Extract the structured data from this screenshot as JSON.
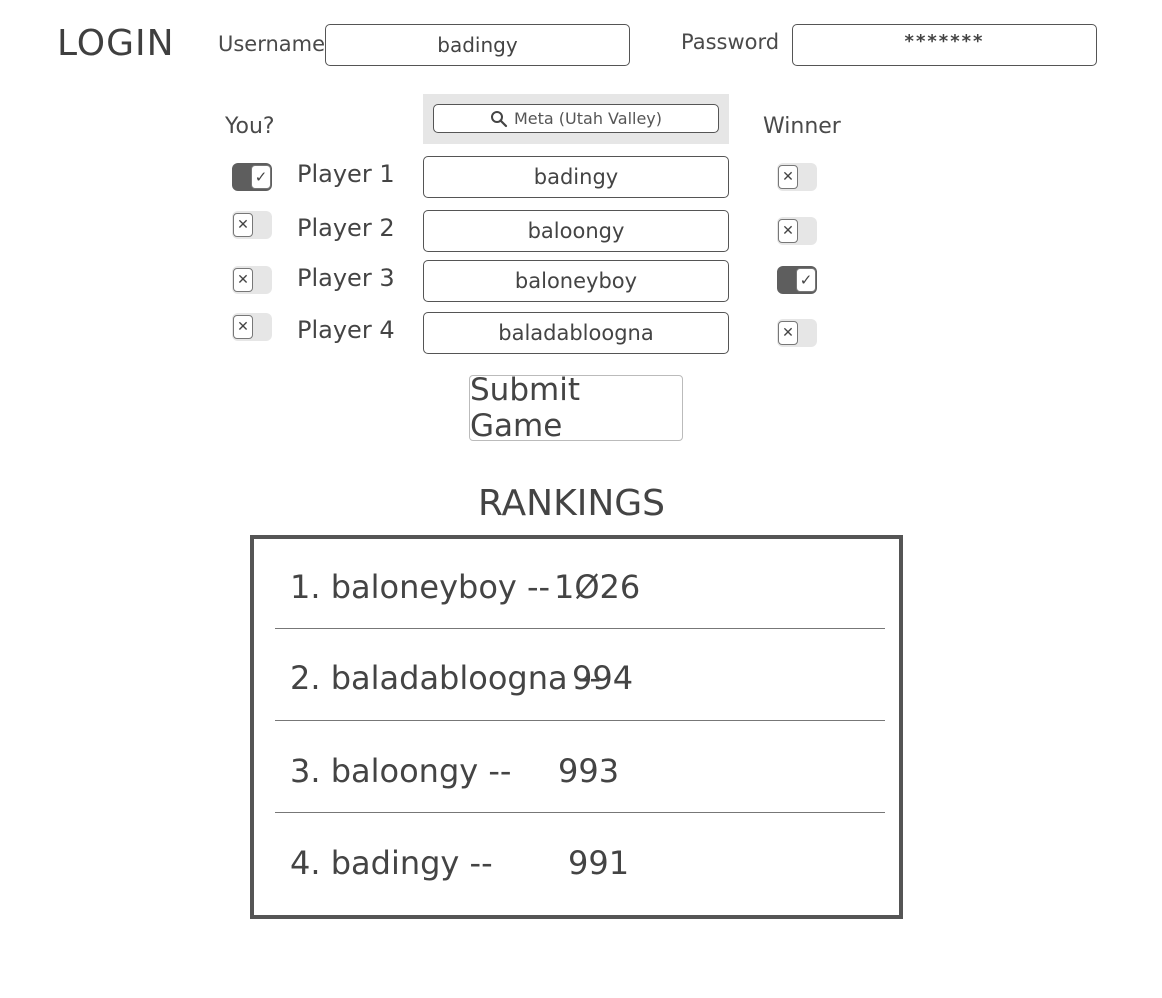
{
  "login": {
    "title": "LOGIN",
    "username_label": "Username",
    "username_value": "badingy",
    "password_label": "Password",
    "password_value": "*******"
  },
  "game": {
    "you_label": "You?",
    "winner_label": "Winner",
    "location_search": "Meta (Utah Valley)",
    "players": [
      {
        "label": "Player 1",
        "name": "badingy",
        "you": true,
        "winner": false
      },
      {
        "label": "Player 2",
        "name": "baloongy",
        "you": false,
        "winner": false
      },
      {
        "label": "Player 3",
        "name": "baloneyboy",
        "you": false,
        "winner": true
      },
      {
        "label": "Player 4",
        "name": "baladabloogna",
        "you": false,
        "winner": false
      }
    ],
    "submit_label": "Submit Game"
  },
  "rankings": {
    "title": "RANKINGS",
    "entries": [
      {
        "text": "1. baloneyboy --",
        "score": "1Ø26"
      },
      {
        "text": "2. baladabloogna --",
        "score": "994"
      },
      {
        "text": "3. baloongy --",
        "score": "993"
      },
      {
        "text": "4. badingy --",
        "score": "991"
      }
    ]
  },
  "icons": {
    "search": "search-icon",
    "check": "check-icon",
    "cross": "x-icon"
  },
  "colors": {
    "toggle_on": "#5e5e5e",
    "toggle_off": "#e6e6e6",
    "search_bg": "#e6e6e6",
    "border": "#555555"
  }
}
